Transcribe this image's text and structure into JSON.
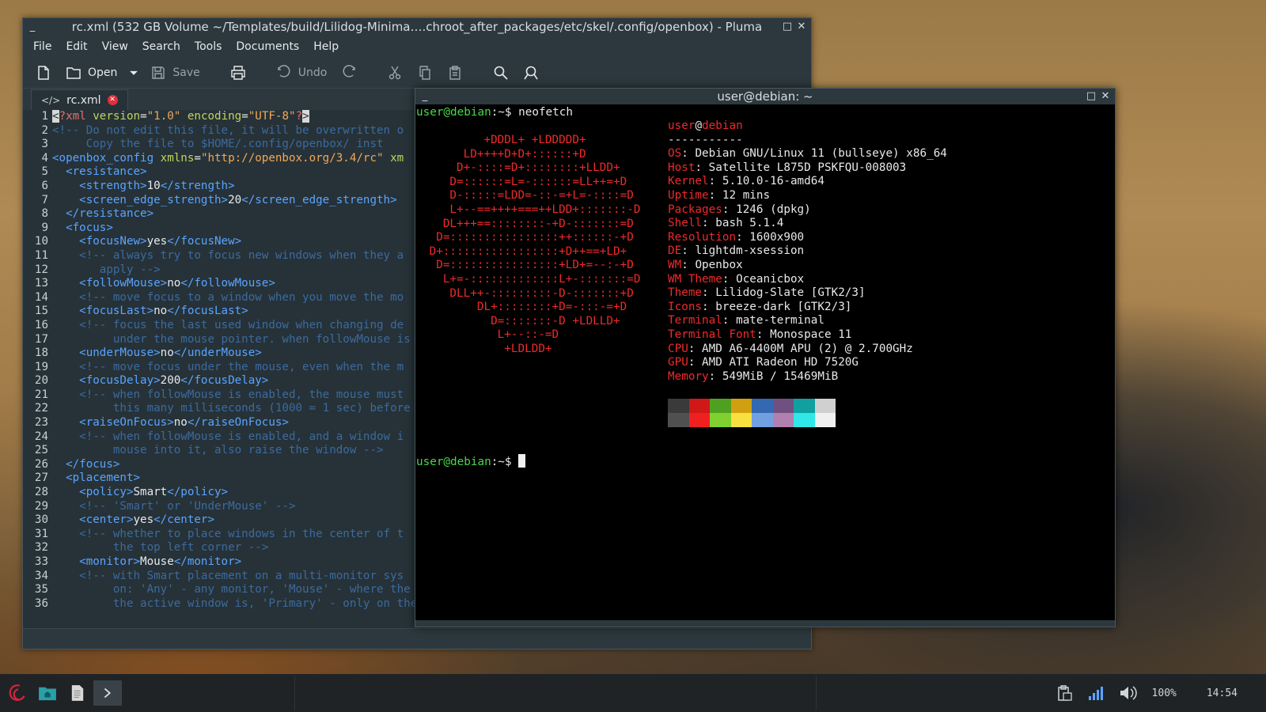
{
  "pluma": {
    "title": "rc.xml (532 GB Volume ~/Templates/build/Lilidog-Minima….chroot_after_packages/etc/skel/.config/openbox) - Pluma",
    "menu": [
      "File",
      "Edit",
      "View",
      "Search",
      "Tools",
      "Documents",
      "Help"
    ],
    "toolbar": {
      "open": "Open",
      "save": "Save",
      "undo": "Undo"
    },
    "tab": {
      "label": "rc.xml"
    },
    "line_numbers": [
      "1",
      "2",
      "3",
      "4",
      "5",
      "6",
      "7",
      "8",
      "9",
      "10",
      "11",
      "12",
      "13",
      "14",
      "15",
      "16",
      "17",
      "18",
      "19",
      "20",
      "21",
      "22",
      "23",
      "24",
      "25",
      "26",
      "27",
      "28",
      "29",
      "30",
      "31",
      "32",
      "33",
      "34",
      "35",
      "36"
    ],
    "code": [
      [
        [
          "pi",
          "<"
        ],
        [
          "pi",
          "?xml "
        ],
        [
          "at",
          "version"
        ],
        [
          "",
          "="
        ],
        [
          "st",
          "\"1.0\""
        ],
        [
          "",
          " "
        ],
        [
          "at",
          "encoding"
        ],
        [
          "",
          "="
        ],
        [
          "st",
          "\"UTF-8\""
        ],
        [
          "pi",
          "?"
        ],
        [
          "pi",
          ">"
        ]
      ],
      [
        [
          "cm",
          "<!-- Do not edit this file, it will be overwritten o"
        ]
      ],
      [
        [
          "cm",
          "     Copy the file to $HOME/.config/openbox/ inst"
        ]
      ],
      [
        [
          "tg",
          "<openbox_config "
        ],
        [
          "at",
          "xmlns"
        ],
        [
          "",
          "="
        ],
        [
          "st",
          "\"http://openbox.org/3.4/rc\""
        ],
        [
          "",
          " "
        ],
        [
          "at",
          "xm"
        ]
      ],
      [
        [
          "tg",
          "  <resistance>"
        ]
      ],
      [
        [
          "tg",
          "    <strength>"
        ],
        [
          "",
          "10"
        ],
        [
          "tg",
          "</strength>"
        ]
      ],
      [
        [
          "tg",
          "    <screen_edge_strength>"
        ],
        [
          "",
          "20"
        ],
        [
          "tg",
          "</screen_edge_strength>"
        ]
      ],
      [
        [
          "tg",
          "  </resistance>"
        ]
      ],
      [
        [
          "tg",
          "  <focus>"
        ]
      ],
      [
        [
          "tg",
          "    <focusNew>"
        ],
        [
          "",
          "yes"
        ],
        [
          "tg",
          "</focusNew>"
        ]
      ],
      [
        [
          "cm",
          "    <!-- always try to focus new windows when they a"
        ]
      ],
      [
        [
          "cm",
          "       apply -->"
        ]
      ],
      [
        [
          "tg",
          "    <followMouse>"
        ],
        [
          "",
          "no"
        ],
        [
          "tg",
          "</followMouse>"
        ]
      ],
      [
        [
          "cm",
          "    <!-- move focus to a window when you move the mo"
        ]
      ],
      [
        [
          "tg",
          "    <focusLast>"
        ],
        [
          "",
          "no"
        ],
        [
          "tg",
          "</focusLast>"
        ]
      ],
      [
        [
          "cm",
          "    <!-- focus the last used window when changing de"
        ]
      ],
      [
        [
          "cm",
          "         under the mouse pointer. when followMouse is"
        ]
      ],
      [
        [
          "tg",
          "    <underMouse>"
        ],
        [
          "",
          "no"
        ],
        [
          "tg",
          "</underMouse>"
        ]
      ],
      [
        [
          "cm",
          "    <!-- move focus under the mouse, even when the m"
        ]
      ],
      [
        [
          "tg",
          "    <focusDelay>"
        ],
        [
          "",
          "200"
        ],
        [
          "tg",
          "</focusDelay>"
        ]
      ],
      [
        [
          "cm",
          "    <!-- when followMouse is enabled, the mouse must"
        ]
      ],
      [
        [
          "cm",
          "         this many milliseconds (1000 = 1 sec) before"
        ]
      ],
      [
        [
          "tg",
          "    <raiseOnFocus>"
        ],
        [
          "",
          "no"
        ],
        [
          "tg",
          "</raiseOnFocus>"
        ]
      ],
      [
        [
          "cm",
          "    <!-- when followMouse is enabled, and a window i"
        ]
      ],
      [
        [
          "cm",
          "         mouse into it, also raise the window -->"
        ]
      ],
      [
        [
          "tg",
          "  </focus>"
        ]
      ],
      [
        [
          "tg",
          "  <placement>"
        ]
      ],
      [
        [
          "tg",
          "    <policy>"
        ],
        [
          "",
          "Smart"
        ],
        [
          "tg",
          "</policy>"
        ]
      ],
      [
        [
          "cm",
          "    <!-- 'Smart' or 'UnderMouse' -->"
        ]
      ],
      [
        [
          "tg",
          "    <center>"
        ],
        [
          "",
          "yes"
        ],
        [
          "tg",
          "</center>"
        ]
      ],
      [
        [
          "cm",
          "    <!-- whether to place windows in the center of t"
        ]
      ],
      [
        [
          "cm",
          "         the top left corner -->"
        ]
      ],
      [
        [
          "tg",
          "    <monitor>"
        ],
        [
          "",
          "Mouse"
        ],
        [
          "tg",
          "</monitor>"
        ]
      ],
      [
        [
          "cm",
          "    <!-- with Smart placement on a multi-monitor sys"
        ]
      ],
      [
        [
          "cm",
          "         on: 'Any' - any monitor, 'Mouse' - where the"
        ]
      ],
      [
        [
          "cm",
          "         the active window is, 'Primary' - only on the"
        ]
      ]
    ]
  },
  "terminal": {
    "title": "user@debian: ~",
    "prompt_user": "user@debian",
    "prompt_path": ":~$ ",
    "command": "neofetch",
    "logo": [
      "         +DDDL+ +LDDDDD+",
      "      LD++++D+D+::::::+D",
      "     D+-::::=D+::::::::+LLDD+",
      "    D=::::::=L=-::::::=LL++=+D",
      "    D-:::::=LDD=-::-=+L=-::::=D",
      "    L+--==++++===++LDD+:::::::-D",
      "   DL+++==::::::::-+D-:::::::=D",
      "  D=::::::::::::::::++::::::-+D",
      " D+:::::::::::::::::+D++==+LD+",
      "  D=::::::::::::::::+LD+=--:-+D",
      "   L+=-:::::::::::::L+-:::::::=D",
      "    DLL++-:::::::::-D-:::::::+D",
      "        DL+::::::::+D=-:::-=+D",
      "          D=:::::::-D +LDLLD+",
      "           L+--::-=D",
      "            +LDLDD+"
    ],
    "info_user": "user",
    "info_host": "debian",
    "separator": "-----------",
    "info": [
      {
        "key": "OS",
        "value": "Debian GNU/Linux 11 (bullseye) x86_64"
      },
      {
        "key": "Host",
        "value": "Satellite L875D PSKFQU-008003"
      },
      {
        "key": "Kernel",
        "value": "5.10.0-16-amd64"
      },
      {
        "key": "Uptime",
        "value": "12 mins"
      },
      {
        "key": "Packages",
        "value": "1246 (dpkg)"
      },
      {
        "key": "Shell",
        "value": "bash 5.1.4"
      },
      {
        "key": "Resolution",
        "value": "1600x900"
      },
      {
        "key": "DE",
        "value": "lightdm-xsession"
      },
      {
        "key": "WM",
        "value": "Openbox"
      },
      {
        "key": "WM Theme",
        "value": "Oceanicbox"
      },
      {
        "key": "Theme",
        "value": "Lilidog-Slate [GTK2/3]"
      },
      {
        "key": "Icons",
        "value": "breeze-dark [GTK2/3]"
      },
      {
        "key": "Terminal",
        "value": "mate-terminal"
      },
      {
        "key": "Terminal Font",
        "value": "Monospace 11"
      },
      {
        "key": "CPU",
        "value": "AMD A6-4400M APU (2) @ 2.700GHz"
      },
      {
        "key": "GPU",
        "value": "AMD ATI Radeon HD 7520G"
      },
      {
        "key": "Memory",
        "value": "549MiB / 15469MiB"
      }
    ],
    "palette_top": [
      "#3a3a3a",
      "#d01818",
      "#50a020",
      "#d0a010",
      "#3468b0",
      "#705080",
      "#10a0a0",
      "#d0d0d0"
    ],
    "palette_bottom": [
      "#505050",
      "#f02020",
      "#80d030",
      "#f8e040",
      "#70a0e0",
      "#b080b0",
      "#30e8e8",
      "#f0f0f0"
    ]
  },
  "taskbar": {
    "volume_label": "100%",
    "clock": "14:54",
    "accent": "#d0243c"
  }
}
